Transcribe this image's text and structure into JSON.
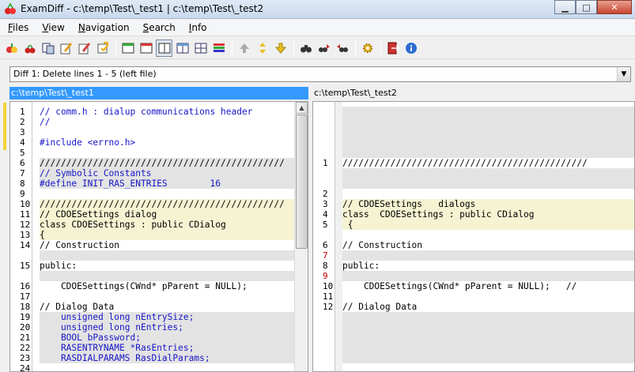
{
  "window": {
    "title": "ExamDiff - c:\\temp\\Test\\_test1  |  c:\\temp\\Test\\_test2",
    "min_glyph": "▁",
    "max_glyph": "□",
    "close_glyph": "✕"
  },
  "menu": [
    {
      "label": "Files",
      "underline": "F",
      "rest": "iles"
    },
    {
      "label": "View",
      "underline": "V",
      "rest": "iew"
    },
    {
      "label": "Navigation",
      "underline": "N",
      "rest": "avigation"
    },
    {
      "label": "Search",
      "underline": "S",
      "rest": "earch"
    },
    {
      "label": "Info",
      "underline": "I",
      "rest": "nfo"
    }
  ],
  "diff_selector": {
    "value": "Diff 1: Delete lines 1 - 5 (left file)"
  },
  "left_pane": {
    "path": "c:\\temp\\Test\\_test1"
  },
  "right_pane": {
    "path": "c:\\temp\\Test\\_test2"
  },
  "left_lines": [
    {
      "n": "1",
      "text": "// comm.h : dialup communications header",
      "bg": "white",
      "color": "blue"
    },
    {
      "n": "2",
      "text": "//",
      "bg": "white",
      "color": "blue"
    },
    {
      "n": "3",
      "text": "",
      "bg": "white",
      "color": "dark"
    },
    {
      "n": "4",
      "text": "#include <errno.h>",
      "bg": "white",
      "color": "blue"
    },
    {
      "n": "5",
      "text": "",
      "bg": "white",
      "color": "dark"
    },
    {
      "n": "6",
      "text": "//////////////////////////////////////////////",
      "bg": "gray",
      "color": "dark"
    },
    {
      "n": "7",
      "text": "// Symbolic Constants",
      "bg": "gray",
      "color": "blue"
    },
    {
      "n": "8",
      "text": "#define INIT_RAS_ENTRIES        16",
      "bg": "gray",
      "color": "blue"
    },
    {
      "n": "9",
      "text": "",
      "bg": "white",
      "color": "dark"
    },
    {
      "n": "10",
      "text": "//////////////////////////////////////////////",
      "bg": "yellow",
      "color": "dark"
    },
    {
      "n": "11",
      "text": "// CDOESettings dialog",
      "bg": "yellow",
      "color": "dark"
    },
    {
      "n": "12",
      "text": "class CDOESettings : public CDialog",
      "bg": "yellow",
      "color": "dark"
    },
    {
      "n": "13",
      "text": "{",
      "bg": "yellow",
      "color": "dark"
    },
    {
      "n": "14",
      "text": "// Construction",
      "bg": "white",
      "color": "dark"
    },
    {
      "n": "",
      "text": "",
      "bg": "gray",
      "color": "dark"
    },
    {
      "n": "15",
      "text": "public:",
      "bg": "white",
      "color": "dark"
    },
    {
      "n": "",
      "text": "",
      "bg": "gray",
      "color": "dark"
    },
    {
      "n": "16",
      "text": "    CDOESettings(CWnd* pParent = NULL);",
      "bg": "white",
      "color": "dark"
    },
    {
      "n": "17",
      "text": "",
      "bg": "white",
      "color": "dark"
    },
    {
      "n": "18",
      "text": "// Dialog Data",
      "bg": "white",
      "color": "dark"
    },
    {
      "n": "19",
      "text": "    unsigned long nEntrySize;",
      "bg": "gray",
      "color": "blue"
    },
    {
      "n": "20",
      "text": "    unsigned long nEntries;",
      "bg": "gray",
      "color": "blue"
    },
    {
      "n": "21",
      "text": "    BOOL bPassword;",
      "bg": "gray",
      "color": "blue"
    },
    {
      "n": "22",
      "text": "    RASENTRYNAME *RasEntries;",
      "bg": "gray",
      "color": "blue"
    },
    {
      "n": "23",
      "text": "    RASDIALPARAMS RasDialParams;",
      "bg": "gray",
      "color": "blue"
    },
    {
      "n": "24",
      "text": "",
      "bg": "white",
      "color": "dark"
    }
  ],
  "right_lines": [
    {
      "n": "",
      "text": "",
      "bg": "gray",
      "color": "dark"
    },
    {
      "n": "",
      "text": "",
      "bg": "gray",
      "color": "dark"
    },
    {
      "n": "",
      "text": "",
      "bg": "gray",
      "color": "dark"
    },
    {
      "n": "",
      "text": "",
      "bg": "gray",
      "color": "dark"
    },
    {
      "n": "",
      "text": "",
      "bg": "gray",
      "color": "dark"
    },
    {
      "n": "1",
      "text": "//////////////////////////////////////////////",
      "bg": "white",
      "color": "dark"
    },
    {
      "n": "",
      "text": "",
      "bg": "gray",
      "color": "dark"
    },
    {
      "n": "",
      "text": "",
      "bg": "gray",
      "color": "dark"
    },
    {
      "n": "2",
      "text": "",
      "bg": "white",
      "color": "dark"
    },
    {
      "n": "3",
      "text": "// CDOESettings   dialogs",
      "bg": "yellow",
      "color": "dark"
    },
    {
      "n": "4",
      "text": "class  CDOESettings : public CDialog",
      "bg": "yellow",
      "color": "dark"
    },
    {
      "n": "5",
      "text": " {",
      "bg": "yellow",
      "color": "dark"
    },
    {
      "n": "",
      "text": "",
      "bg": "white",
      "color": "dark"
    },
    {
      "n": "6",
      "text": "// Construction",
      "bg": "white",
      "color": "dark"
    },
    {
      "n": "7",
      "text": "",
      "bg": "gray",
      "color": "dark",
      "ncolor": "red"
    },
    {
      "n": "8",
      "text": "public:",
      "bg": "white",
      "color": "dark"
    },
    {
      "n": "9",
      "text": "",
      "bg": "gray",
      "color": "dark",
      "ncolor": "red"
    },
    {
      "n": "10",
      "text": "    CDOESettings(CWnd* pParent = NULL);   //",
      "bg": "white",
      "color": "dark"
    },
    {
      "n": "11",
      "text": "",
      "bg": "white",
      "color": "dark"
    },
    {
      "n": "12",
      "text": "// Dialog Data",
      "bg": "white",
      "color": "dark"
    },
    {
      "n": "",
      "text": "",
      "bg": "gray",
      "color": "dark"
    },
    {
      "n": "",
      "text": "",
      "bg": "gray",
      "color": "dark"
    },
    {
      "n": "",
      "text": "",
      "bg": "gray",
      "color": "dark"
    },
    {
      "n": "",
      "text": "",
      "bg": "gray",
      "color": "dark"
    },
    {
      "n": "",
      "text": "",
      "bg": "gray",
      "color": "dark"
    },
    {
      "n": "",
      "text": "",
      "bg": "white",
      "color": "dark"
    }
  ],
  "colors": {
    "selected_header": "#3399ff",
    "changed_bg": "#f5f3d2",
    "deleted_bg": "#e3e3e3",
    "code_blue": "#1515c8"
  },
  "toolbar_icons": [
    "open-files-icon",
    "cherry-icon",
    "new-compare-icon",
    "edit-left-icon",
    "edit-right-icon",
    "save-icon",
    "sep",
    "layout-green-icon",
    "layout-red-icon",
    "layout-split-icon",
    "layout-grid-icon",
    "layout-columns-icon",
    "layout-bars-icon",
    "sep",
    "arrow-up-icon",
    "arrow-updown-icon",
    "arrow-down-icon",
    "sep",
    "binoculars-icon",
    "find-next-icon",
    "find-prev-icon",
    "sep",
    "options-gear-icon",
    "sep",
    "exit-icon",
    "info-icon"
  ]
}
